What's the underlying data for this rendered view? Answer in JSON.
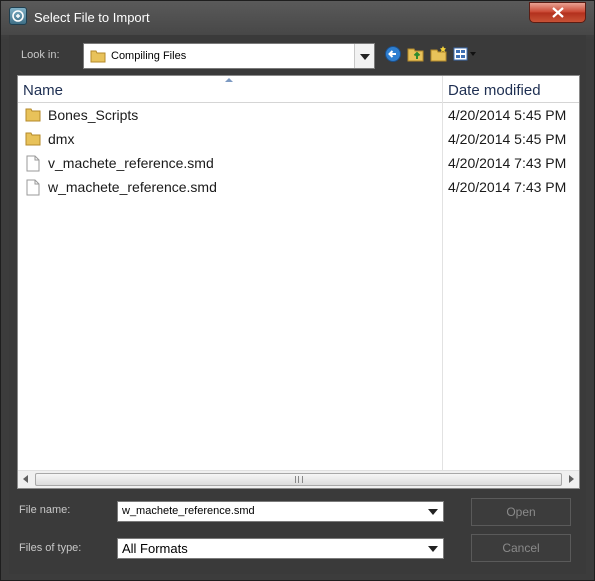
{
  "window": {
    "title": "Select File to Import"
  },
  "toolbar": {
    "look_in_label": "Look in:",
    "look_in_value": "Compiling Files",
    "icons": [
      "back-icon",
      "up-folder-icon",
      "new-folder-icon",
      "view-menu-icon"
    ]
  },
  "file_list": {
    "columns": [
      "Name",
      "Date modified"
    ],
    "rows": [
      {
        "name": "Bones_Scripts",
        "date": "4/20/2014 5:45 PM",
        "type": "folder"
      },
      {
        "name": "dmx",
        "date": "4/20/2014 5:45 PM",
        "type": "folder"
      },
      {
        "name": "v_machete_reference.smd",
        "date": "4/20/2014 7:43 PM",
        "type": "file"
      },
      {
        "name": "w_machete_reference.smd",
        "date": "4/20/2014 7:43 PM",
        "type": "file"
      }
    ]
  },
  "footer": {
    "file_name_label": "File name:",
    "file_name_value": "w_machete_reference.smd",
    "files_of_type_label": "Files of type:",
    "files_of_type_value": "All Formats",
    "open_label": "Open",
    "cancel_label": "Cancel"
  },
  "colors": {
    "chrome": "#3a3a3a",
    "close_button": "#c8432e",
    "header_text": "#1e2f52"
  }
}
